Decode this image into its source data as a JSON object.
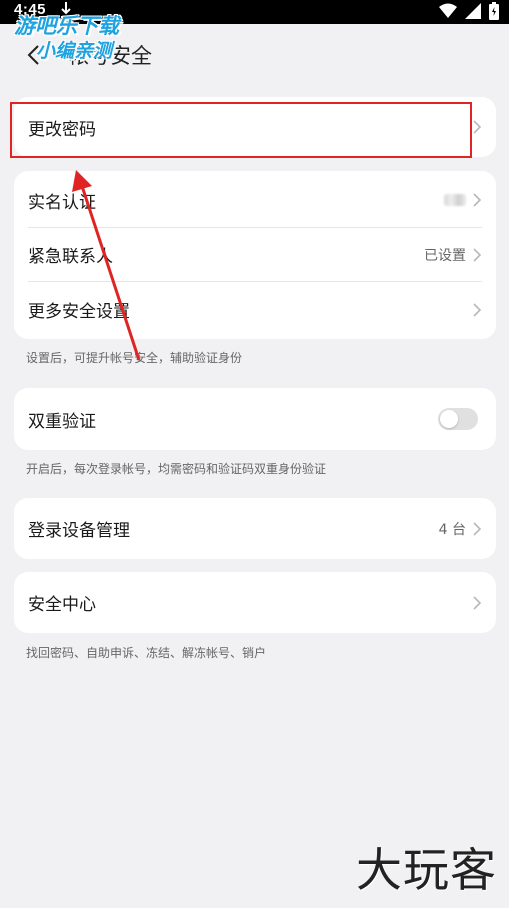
{
  "status_bar": {
    "time": "4:45"
  },
  "watermark": {
    "line1": "游吧乐下载",
    "line2": "小编亲测",
    "bottom": "大玩客"
  },
  "header": {
    "title": "帐号安全"
  },
  "sections": {
    "password": {
      "label": "更改密码"
    },
    "identity": {
      "realname_label": "实名认证",
      "emergency_label": "紧急联系人",
      "emergency_value": "已设置",
      "more_label": "更多安全设置",
      "hint": "设置后，可提升帐号安全，辅助验证身份"
    },
    "two_factor": {
      "label": "双重验证",
      "enabled": false,
      "hint": "开启后，每次登录帐号，均需密码和验证码双重身份验证"
    },
    "devices": {
      "label": "登录设备管理",
      "value": "4 台"
    },
    "center": {
      "label": "安全中心",
      "hint": "找回密码、自助申诉、冻结、解冻帐号、销户"
    }
  },
  "colors": {
    "annotation": "#e02424",
    "background": "#f1f1f3"
  },
  "icons": [
    "back-arrow-icon",
    "chevron-right-icon",
    "wifi-icon",
    "signal-icon",
    "battery-icon",
    "download-icon"
  ]
}
